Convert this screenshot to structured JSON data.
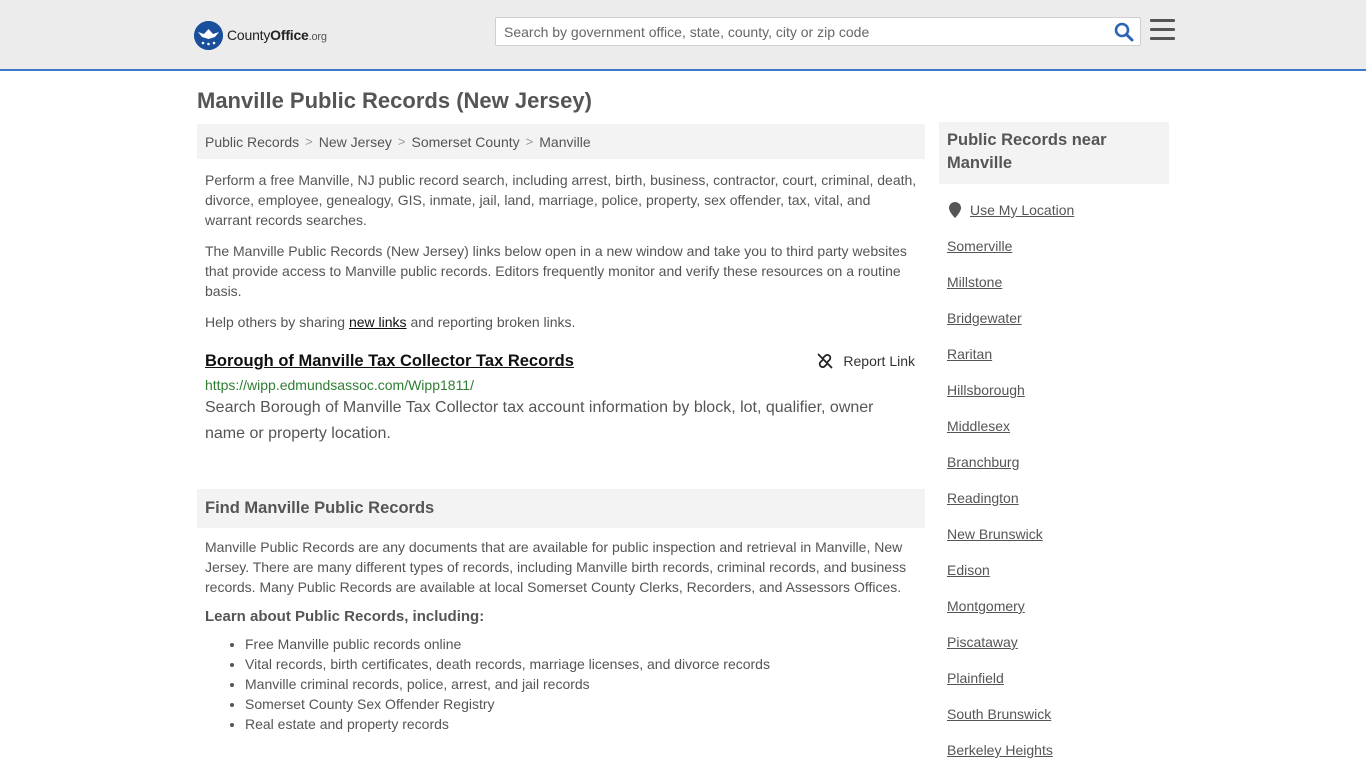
{
  "header": {
    "logo": {
      "county": "County",
      "office": "Office",
      "org": ".org"
    },
    "search_placeholder": "Search by government office, state, county, city or zip code",
    "search_icon": "search-icon",
    "menu_icon": "hamburger-menu-icon",
    "accent_color": "#3b78c8"
  },
  "page": {
    "title": "Manville Public Records (New Jersey)"
  },
  "breadcrumb": [
    "Public Records",
    "New Jersey",
    "Somerset County",
    "Manville"
  ],
  "intro": {
    "p1": "Perform a free Manville, NJ public record search, including arrest, birth, business, contractor, court, criminal, death, divorce, employee, genealogy, GIS, inmate, jail, land, marriage, police, property, sex offender, tax, vital, and warrant records searches.",
    "p2": "The Manville Public Records (New Jersey) links below open in a new window and take you to third party websites that provide access to Manville public records. Editors frequently monitor and verify these resources on a routine basis.",
    "p3_before": "Help others by sharing ",
    "p3_link": "new links",
    "p3_after": " and reporting broken links."
  },
  "record": {
    "title": "Borough of Manville Tax Collector Tax Records",
    "report_label": "Report Link",
    "url": "https://wipp.edmundsassoc.com/Wipp1811/",
    "url_color": "#2e7d32",
    "description": "Search Borough of Manville Tax Collector tax account information by block, lot, qualifier, owner name or property location."
  },
  "find_section": {
    "heading": "Find Manville Public Records",
    "body": "Manville Public Records are any documents that are available for public inspection and retrieval in Manville, New Jersey. There are many different types of records, including Manville birth records, criminal records, and business records. Many Public Records are available at local Somerset County Clerks, Recorders, and Assessors Offices.",
    "learn_heading": "Learn about Public Records, including:",
    "items": [
      "Free Manville public records online",
      "Vital records, birth certificates, death records, marriage licenses, and divorce records",
      "Manville criminal records, police, arrest, and jail records",
      "Somerset County Sex Offender Registry",
      "Real estate and property records"
    ]
  },
  "sidebar": {
    "heading": "Public Records near Manville",
    "use_location": "Use My Location",
    "places": [
      "Somerville",
      "Millstone",
      "Bridgewater",
      "Raritan",
      "Hillsborough",
      "Middlesex",
      "Branchburg",
      "Readington",
      "New Brunswick",
      "Edison",
      "Montgomery",
      "Piscataway",
      "Plainfield",
      "South Brunswick",
      "Berkeley Heights"
    ]
  }
}
